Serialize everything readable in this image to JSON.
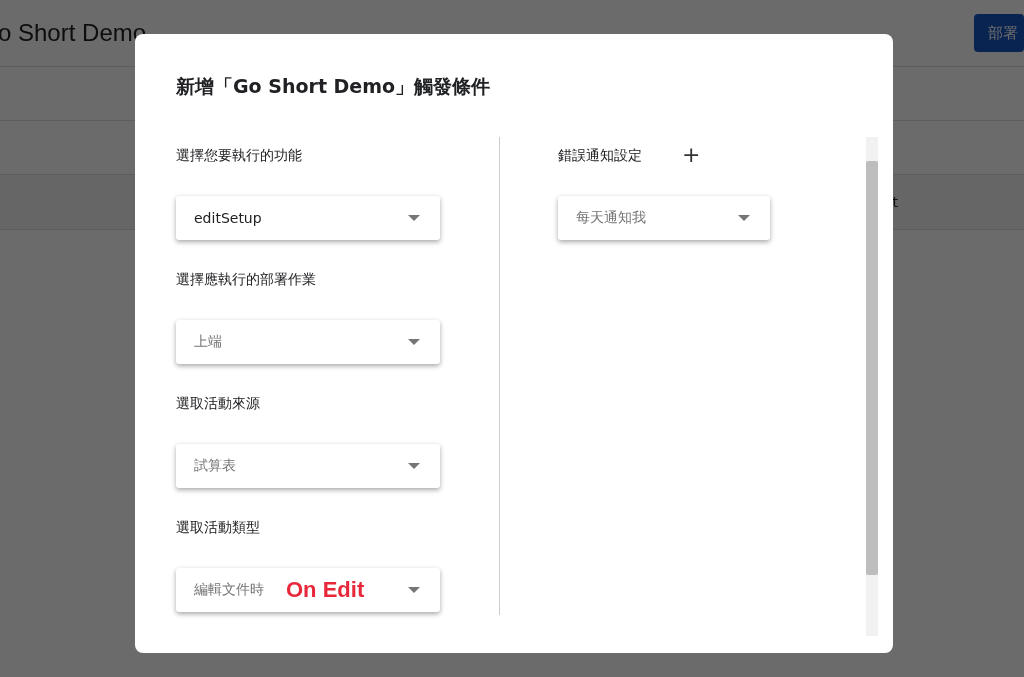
{
  "page": {
    "title": "o Short Demo",
    "deploy_button": "部署",
    "column_fragment": "t"
  },
  "dialog": {
    "title": "新增「Go Short Demo」觸發條件",
    "fields": [
      {
        "label": "選擇您要執行的功能",
        "value": "editSetup",
        "disabled": false
      },
      {
        "label": "選擇應執行的部署作業",
        "value": "上端",
        "disabled": true
      },
      {
        "label": "選取活動來源",
        "value": "試算表",
        "disabled": true
      },
      {
        "label": "選取活動類型",
        "value": "編輯文件時",
        "disabled": true,
        "annotation": "On Edit"
      }
    ],
    "notification": {
      "label": "錯誤通知設定",
      "add": "+",
      "value": "每天通知我",
      "disabled": true
    }
  }
}
